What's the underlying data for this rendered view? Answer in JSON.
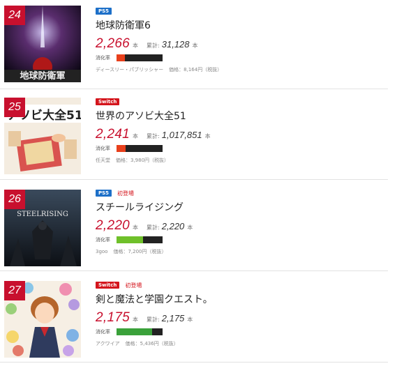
{
  "items": [
    {
      "rank": "24",
      "platform": "PS5",
      "platform_color": "#1c6fc8",
      "debut": "",
      "title": "地球防衛軍6",
      "sales": "2,266",
      "unit": "本",
      "total_label": "累計:",
      "total": "31,128",
      "digest_label": "消化率",
      "digest_fraction": 0.18,
      "digest_color": "#e8401c",
      "publisher": "ディースリー・パブリッシャー",
      "price": "価格：8,164円（税抜）",
      "cover_text": "地球防衛軍"
    },
    {
      "rank": "25",
      "platform": "Switch",
      "platform_color": "#d4151c",
      "debut": "",
      "title": "世界のアソビ大全51",
      "sales": "2,241",
      "unit": "本",
      "total_label": "累計:",
      "total": "1,017,851",
      "digest_label": "消化率",
      "digest_fraction": 0.2,
      "digest_color": "#e8401c",
      "publisher": "任天堂",
      "price": "価格：3,980円（税抜）",
      "cover_text": "アソビ大全51"
    },
    {
      "rank": "26",
      "platform": "PS5",
      "platform_color": "#1c6fc8",
      "debut": "初登場",
      "title": "スチールライジング",
      "sales": "2,220",
      "unit": "本",
      "total_label": "累計:",
      "total": "2,220",
      "digest_label": "消化率",
      "digest_fraction": 0.58,
      "digest_color": "#6fc02a",
      "publisher": "3goo",
      "price": "価格：7,200円（税抜）",
      "cover_text": "STEELRISING"
    },
    {
      "rank": "27",
      "platform": "Switch",
      "platform_color": "#d4151c",
      "debut": "初登場",
      "title": "剣と魔法と学園クエスト。",
      "sales": "2,175",
      "unit": "本",
      "total_label": "累計:",
      "total": "2,175",
      "digest_label": "消化率",
      "digest_fraction": 0.78,
      "digest_color": "#3aa13a",
      "publisher": "アクワイア",
      "price": "価格：5,436円（税抜）",
      "cover_text": ""
    }
  ]
}
